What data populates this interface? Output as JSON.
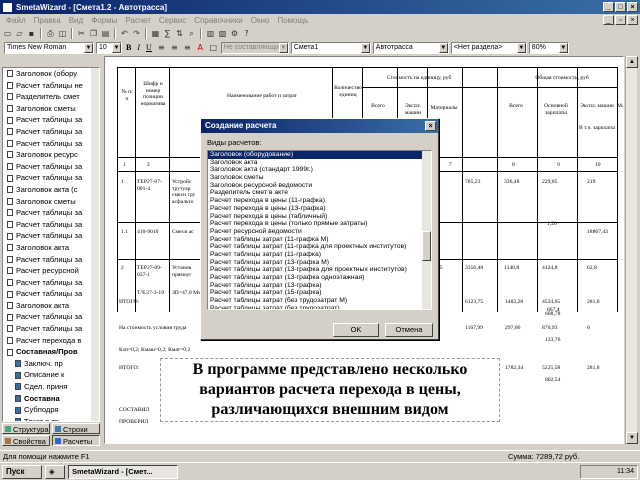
{
  "window": {
    "title": "SmetaWizard - [Смета1.2 - Автотрасса]"
  },
  "menu": [
    "Файл",
    "Правка",
    "Вид",
    "Формы",
    "Расчет",
    "Сервис",
    "Справочники",
    "Окно",
    "Помощь"
  ],
  "toolbar2": {
    "font": "Times New Roman",
    "size": "10",
    "bold": "B",
    "italic": "I",
    "underline": "U",
    "style_combo": "Не составляющие",
    "doc_combo": "Смета1",
    "object_combo": "Автотрасса",
    "section_combo": "<Нет раздела>",
    "zoom": "80%"
  },
  "tree": {
    "items": [
      "Заголовок (обору",
      "Расчет таблицы не",
      "Разделитель смет",
      "Заголовок сметы",
      "Расчет таблицы за",
      "Расчет таблицы за",
      "Расчет таблицы за",
      "Заголовок ресурс",
      "Расчет таблицы за",
      "Расчет таблицы за",
      "Заголовок акта (с",
      "Заголовок сметы",
      "Расчет таблицы за",
      "Расчет таблицы за",
      "Расчет таблицы за",
      "Заголовок акта",
      "Расчет таблицы за",
      "Расчет ресурсной",
      "Расчет таблицы за",
      "Расчет таблицы за",
      "Заголовок акта",
      "Расчет таблицы за",
      "Расчет таблицы за",
      "Расчет перехода в",
      "Составная/Пров",
      "Заключ. пр",
      "Описание к",
      "Сдел. приня",
      "Составна",
      "Субподря",
      "Текст в тр",
      "Текст в тр",
      "Текстовая"
    ],
    "tabs": [
      "Структура",
      "Строки",
      "Свойства",
      "Расчеты"
    ]
  },
  "sheet": {
    "headers": {
      "col1": "№ п/п",
      "col2": "Шифр и номер позиции норматива",
      "col3": "Наименование работ и затрат",
      "col4": "Количество единиц",
      "col5": "Стоимость на единицу, руб",
      "col5a": "Всего",
      "col5b": "Экспл. машин",
      "col5c": "Материалы",
      "col6": "Общая стоимость, руб",
      "col6a": "Всего",
      "col6b": "Основной зарплаты",
      "col6c": "Экспл. машин",
      "col6c2": "В т.ч. зарплаты",
      "col6d": "Материалы"
    },
    "numbers": [
      "1",
      "2",
      "7",
      "8",
      "9",
      "10",
      "11"
    ],
    "rows": [
      {
        "n": "1",
        "code": "ТЕР27-07-001-4",
        "name": "Устройс трутуар смеси гру асфальто",
        "c1": "87,6",
        "c2": "785,23",
        "c3": "336,48",
        "c4": "229,05",
        "c5": "219",
        "c6": "1,26"
      },
      {
        "n": "1.1",
        "code": "410-9010",
        "name": "Смеси ас",
        "c1": "1657",
        "c5": "18867,43"
      },
      {
        "n": "2",
        "code": "ТЕР27-09-037-1",
        "name": "Установ прямоуг",
        "c1": "3,1395",
        "c2": "3356,48",
        "c3": "1140,8",
        "c4": "4124,8",
        "c5": "62,8",
        "c6": "667,4",
        "extra": "Т.Ч.27-3-19",
        "extra2": "ЗП=47,8 Мм=2,1"
      }
    ],
    "totals": [
      {
        "label": "ИТОГО:",
        "v1": "6123,75",
        "v2": "1483,28",
        "v3": "4534,65",
        "v4": "281,8",
        "v5": "608,78"
      },
      {
        "label": "На стоимость условия труда",
        "v1": "1167,99",
        "v2": "297,06",
        "v3": "870,93",
        "v4": "0",
        "v5": "133,76"
      },
      {
        "label": "Кзп=0,2; Кмаш=0,2; Кмат=0,2"
      },
      {
        "label": "ИТОГО:",
        "v1": "7291,72",
        "v2": "1782,34",
        "v3": "5225,58",
        "v4": "281,8",
        "v5": "802,54"
      }
    ],
    "composed": "СОСТАВИЛ",
    "checked": "ПРОВЕРИЛ"
  },
  "dialog": {
    "title": "Создание расчета",
    "label": "Виды расчетов:",
    "items": [
      "Заголовок (оборудование)",
      "Заголовок акта",
      "Заголовок акта (стандарт 1999г.)",
      "Заголовок сметы",
      "Заголовок ресурсной ведомости",
      "Разделитель смет в акте",
      "Расчет перехода в цены (11-графка)",
      "Расчет перехода в цены (13-графка)",
      "Расчет перехода в цены (табличный)",
      "Расчет перехода в цены (только прямые затраты)",
      "Расчет ресурсной ведомости",
      "Расчет таблицы затрат (11-графка М)",
      "Расчет таблицы затрат (11-графка для проектных институтов)",
      "Расчет таблицы затрат (11-графка)",
      "Расчет таблицы затрат (13-графка М)",
      "Расчет таблицы затрат (13-графка для проектных институтов)",
      "Расчет таблицы затрат (13-графка одноэтажная)",
      "Расчет таблицы затрат (13-графка)",
      "Расчет таблицы затрат (15-графка)",
      "Расчет таблицы затрат (без трудозатрат М)",
      "Расчет таблицы затрат (без трудозатрат)"
    ],
    "ok": "OK",
    "cancel": "Отмена"
  },
  "caption": {
    "line1": "В программе представлено несколько",
    "line2": "вариантов расчета перехода в цены,",
    "line3": "различающихся внешним видом"
  },
  "status": {
    "help": "Для помощи нажмите F1",
    "sum": "Сумма: 7289,72 руб."
  },
  "taskbar": {
    "start": "Пуск",
    "task": "SmetaWizard - [Смет...",
    "clock": "11:34"
  }
}
